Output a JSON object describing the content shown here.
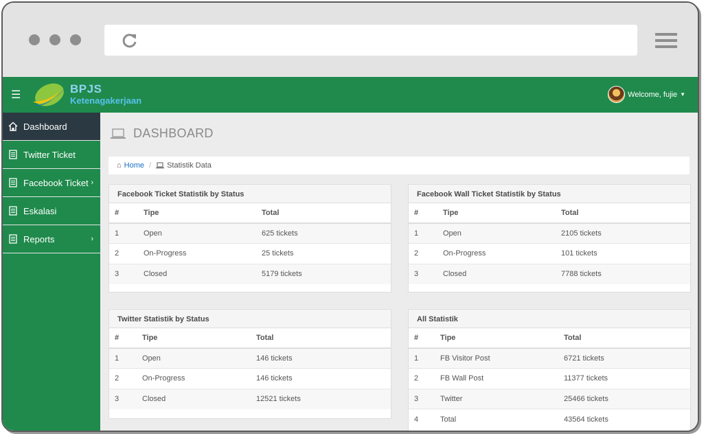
{
  "topbar": {
    "menu_icon": "hamburger-icon",
    "logo_line1": "BPJS",
    "logo_line2": "Ketenagakerjaan",
    "welcome": "Welcome, fujie"
  },
  "sidebar": {
    "items": [
      {
        "label": "Dashboard",
        "icon": "home-icon"
      },
      {
        "label": "Twitter Ticket",
        "icon": "document-icon"
      },
      {
        "label": "Facebook Ticket",
        "icon": "document-icon"
      },
      {
        "label": "Eskalasi",
        "icon": "document-icon"
      },
      {
        "label": "Reports",
        "icon": "document-icon"
      }
    ]
  },
  "page": {
    "title": "DASHBOARD",
    "breadcrumb_home": "Home",
    "breadcrumb_current": "Statistik Data"
  },
  "panels": {
    "facebook": {
      "title": "Facebook Ticket Statistik by Status",
      "headers": [
        "#",
        "Tipe",
        "Total"
      ],
      "rows": [
        [
          "1",
          "Open",
          "625 tickets"
        ],
        [
          "2",
          "On-Progress",
          "25 tickets"
        ],
        [
          "3",
          "Closed",
          "5179 tickets"
        ]
      ]
    },
    "fbwall": {
      "title": "Facebook Wall Ticket Statistik by Status",
      "headers": [
        "#",
        "Tipe",
        "Total"
      ],
      "rows": [
        [
          "1",
          "Open",
          "2105 tickets"
        ],
        [
          "2",
          "On-Progress",
          "101 tickets"
        ],
        [
          "3",
          "Closed",
          "7788 tickets"
        ]
      ]
    },
    "twitter": {
      "title": "Twitter Statistik by Status",
      "headers": [
        "#",
        "Tipe",
        "Total"
      ],
      "rows": [
        [
          "1",
          "Open",
          "146 tickets"
        ],
        [
          "2",
          "On-Progress",
          "146 tickets"
        ],
        [
          "3",
          "Closed",
          "12521 tickets"
        ]
      ]
    },
    "all": {
      "title": "All Statistik",
      "headers": [
        "#",
        "Tipe",
        "Total"
      ],
      "rows": [
        [
          "1",
          "FB Visitor Post",
          "6721 tickets"
        ],
        [
          "2",
          "FB Wall Post",
          "11377 tickets"
        ],
        [
          "3",
          "Twitter",
          "25466 tickets"
        ],
        [
          "4",
          "Total",
          "43564 tickets"
        ]
      ]
    }
  }
}
